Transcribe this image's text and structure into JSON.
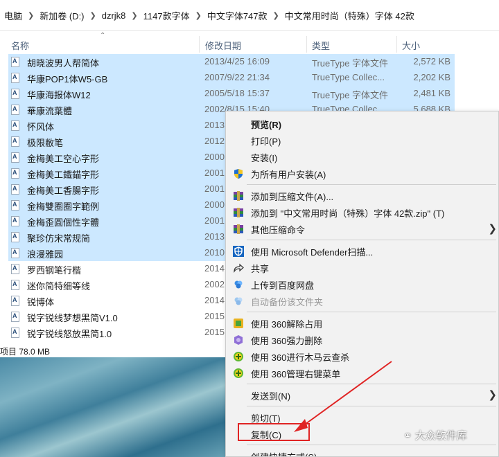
{
  "breadcrumb": [
    "电脑",
    "新加卷 (D:)",
    "dzrjk8",
    "1147款字体",
    "中文字体747款",
    "中文常用时尚（特殊）字体 42款"
  ],
  "columns": {
    "name": "名称",
    "date": "修改日期",
    "type": "类型",
    "size": "大小"
  },
  "files": [
    {
      "name": "胡晓波男人帮简体",
      "date": "2013/4/25 16:09",
      "type": "TrueType 字体文件",
      "size": "2,572 KB",
      "selected": true
    },
    {
      "name": "华康POP1体W5-GB",
      "date": "2007/9/22 21:34",
      "type": "TrueType Collec...",
      "size": "2,202 KB",
      "selected": true
    },
    {
      "name": "华康海报体W12",
      "date": "2005/5/18 15:37",
      "type": "TrueType 字体文件",
      "size": "2,481 KB",
      "selected": true
    },
    {
      "name": "華康流葉體",
      "date": "2002/8/15 15:40",
      "type": "TrueType Collec...",
      "size": "5,688 KB",
      "selected": true
    },
    {
      "name": "怀风体",
      "date": "2013",
      "type": "",
      "size": "",
      "selected": true
    },
    {
      "name": "极限敝笔",
      "date": "2012",
      "type": "",
      "size": "",
      "selected": true
    },
    {
      "name": "金梅美工空心字形",
      "date": "2000",
      "type": "",
      "size": "",
      "selected": true
    },
    {
      "name": "金梅美工鐵錨字形",
      "date": "2001",
      "type": "",
      "size": "",
      "selected": true
    },
    {
      "name": "金梅美工香腸字形",
      "date": "2001",
      "type": "",
      "size": "",
      "selected": true
    },
    {
      "name": "金梅雙圈圈字範例",
      "date": "2000",
      "type": "",
      "size": "",
      "selected": true
    },
    {
      "name": "金梅歪圓個性字體",
      "date": "2001",
      "type": "",
      "size": "",
      "selected": true
    },
    {
      "name": "聚珍仿宋常规简",
      "date": "2013",
      "type": "",
      "size": "",
      "selected": true
    },
    {
      "name": "浪漫雅园",
      "date": "2010",
      "type": "",
      "size": "",
      "selected": true
    },
    {
      "name": "罗西钢笔行楷",
      "date": "2014",
      "type": "",
      "size": "",
      "selected": false
    },
    {
      "name": "迷你简特细等线",
      "date": "2002",
      "type": "",
      "size": "",
      "selected": false
    },
    {
      "name": "锐博体",
      "date": "2014",
      "type": "",
      "size": "",
      "selected": false
    },
    {
      "name": "锐字锐线梦想黑简V1.0",
      "date": "2015",
      "type": "",
      "size": "",
      "selected": false
    },
    {
      "name": "锐字锐线怒放黑简1.0",
      "date": "2015",
      "type": "",
      "size": "",
      "selected": false
    }
  ],
  "status": "项目 78.0 MB",
  "menu": {
    "preview": "预览(R)",
    "print": "打印(P)",
    "install": "安装(I)",
    "install_all": "为所有用户安装(A)",
    "add_archive": "添加到压缩文件(A)...",
    "add_zip": "添加到 \"中文常用时尚（特殊）字体 42款.zip\" (T)",
    "other_compress": "其他压缩命令",
    "defender": "使用 Microsoft Defender扫描...",
    "share": "共享",
    "baidu_upload": "上传到百度网盘",
    "auto_backup": "自动备份该文件夹",
    "unlock_360": "使用 360解除占用",
    "force_delete_360": "使用 360强力删除",
    "trojan_scan_360": "使用 360进行木马云查杀",
    "manage_menu_360": "使用 360管理右键菜单",
    "send_to": "发送到(N)",
    "cut": "剪切(T)",
    "copy": "复制(C)",
    "create_shortcut": "创建快捷方式(S)"
  },
  "watermark": "大众软件库",
  "colors": {
    "selection": "#cce8ff",
    "highlight_box": "#e02424",
    "menu_bg": "#f2f2f2"
  }
}
